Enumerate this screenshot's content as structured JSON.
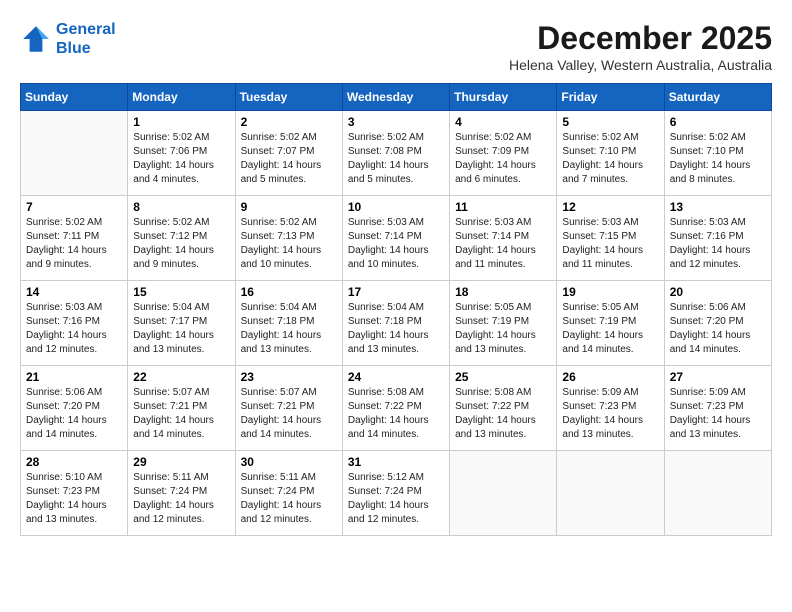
{
  "logo": {
    "line1": "General",
    "line2": "Blue"
  },
  "title": "December 2025",
  "location": "Helena Valley, Western Australia, Australia",
  "header_days": [
    "Sunday",
    "Monday",
    "Tuesday",
    "Wednesday",
    "Thursday",
    "Friday",
    "Saturday"
  ],
  "weeks": [
    [
      {
        "day": "",
        "sunrise": "",
        "sunset": "",
        "daylight": ""
      },
      {
        "day": "1",
        "sunrise": "Sunrise: 5:02 AM",
        "sunset": "Sunset: 7:06 PM",
        "daylight": "Daylight: 14 hours and 4 minutes."
      },
      {
        "day": "2",
        "sunrise": "Sunrise: 5:02 AM",
        "sunset": "Sunset: 7:07 PM",
        "daylight": "Daylight: 14 hours and 5 minutes."
      },
      {
        "day": "3",
        "sunrise": "Sunrise: 5:02 AM",
        "sunset": "Sunset: 7:08 PM",
        "daylight": "Daylight: 14 hours and 5 minutes."
      },
      {
        "day": "4",
        "sunrise": "Sunrise: 5:02 AM",
        "sunset": "Sunset: 7:09 PM",
        "daylight": "Daylight: 14 hours and 6 minutes."
      },
      {
        "day": "5",
        "sunrise": "Sunrise: 5:02 AM",
        "sunset": "Sunset: 7:10 PM",
        "daylight": "Daylight: 14 hours and 7 minutes."
      },
      {
        "day": "6",
        "sunrise": "Sunrise: 5:02 AM",
        "sunset": "Sunset: 7:10 PM",
        "daylight": "Daylight: 14 hours and 8 minutes."
      }
    ],
    [
      {
        "day": "7",
        "sunrise": "Sunrise: 5:02 AM",
        "sunset": "Sunset: 7:11 PM",
        "daylight": "Daylight: 14 hours and 9 minutes."
      },
      {
        "day": "8",
        "sunrise": "Sunrise: 5:02 AM",
        "sunset": "Sunset: 7:12 PM",
        "daylight": "Daylight: 14 hours and 9 minutes."
      },
      {
        "day": "9",
        "sunrise": "Sunrise: 5:02 AM",
        "sunset": "Sunset: 7:13 PM",
        "daylight": "Daylight: 14 hours and 10 minutes."
      },
      {
        "day": "10",
        "sunrise": "Sunrise: 5:03 AM",
        "sunset": "Sunset: 7:14 PM",
        "daylight": "Daylight: 14 hours and 10 minutes."
      },
      {
        "day": "11",
        "sunrise": "Sunrise: 5:03 AM",
        "sunset": "Sunset: 7:14 PM",
        "daylight": "Daylight: 14 hours and 11 minutes."
      },
      {
        "day": "12",
        "sunrise": "Sunrise: 5:03 AM",
        "sunset": "Sunset: 7:15 PM",
        "daylight": "Daylight: 14 hours and 11 minutes."
      },
      {
        "day": "13",
        "sunrise": "Sunrise: 5:03 AM",
        "sunset": "Sunset: 7:16 PM",
        "daylight": "Daylight: 14 hours and 12 minutes."
      }
    ],
    [
      {
        "day": "14",
        "sunrise": "Sunrise: 5:03 AM",
        "sunset": "Sunset: 7:16 PM",
        "daylight": "Daylight: 14 hours and 12 minutes."
      },
      {
        "day": "15",
        "sunrise": "Sunrise: 5:04 AM",
        "sunset": "Sunset: 7:17 PM",
        "daylight": "Daylight: 14 hours and 13 minutes."
      },
      {
        "day": "16",
        "sunrise": "Sunrise: 5:04 AM",
        "sunset": "Sunset: 7:18 PM",
        "daylight": "Daylight: 14 hours and 13 minutes."
      },
      {
        "day": "17",
        "sunrise": "Sunrise: 5:04 AM",
        "sunset": "Sunset: 7:18 PM",
        "daylight": "Daylight: 14 hours and 13 minutes."
      },
      {
        "day": "18",
        "sunrise": "Sunrise: 5:05 AM",
        "sunset": "Sunset: 7:19 PM",
        "daylight": "Daylight: 14 hours and 13 minutes."
      },
      {
        "day": "19",
        "sunrise": "Sunrise: 5:05 AM",
        "sunset": "Sunset: 7:19 PM",
        "daylight": "Daylight: 14 hours and 14 minutes."
      },
      {
        "day": "20",
        "sunrise": "Sunrise: 5:06 AM",
        "sunset": "Sunset: 7:20 PM",
        "daylight": "Daylight: 14 hours and 14 minutes."
      }
    ],
    [
      {
        "day": "21",
        "sunrise": "Sunrise: 5:06 AM",
        "sunset": "Sunset: 7:20 PM",
        "daylight": "Daylight: 14 hours and 14 minutes."
      },
      {
        "day": "22",
        "sunrise": "Sunrise: 5:07 AM",
        "sunset": "Sunset: 7:21 PM",
        "daylight": "Daylight: 14 hours and 14 minutes."
      },
      {
        "day": "23",
        "sunrise": "Sunrise: 5:07 AM",
        "sunset": "Sunset: 7:21 PM",
        "daylight": "Daylight: 14 hours and 14 minutes."
      },
      {
        "day": "24",
        "sunrise": "Sunrise: 5:08 AM",
        "sunset": "Sunset: 7:22 PM",
        "daylight": "Daylight: 14 hours and 14 minutes."
      },
      {
        "day": "25",
        "sunrise": "Sunrise: 5:08 AM",
        "sunset": "Sunset: 7:22 PM",
        "daylight": "Daylight: 14 hours and 13 minutes."
      },
      {
        "day": "26",
        "sunrise": "Sunrise: 5:09 AM",
        "sunset": "Sunset: 7:23 PM",
        "daylight": "Daylight: 14 hours and 13 minutes."
      },
      {
        "day": "27",
        "sunrise": "Sunrise: 5:09 AM",
        "sunset": "Sunset: 7:23 PM",
        "daylight": "Daylight: 14 hours and 13 minutes."
      }
    ],
    [
      {
        "day": "28",
        "sunrise": "Sunrise: 5:10 AM",
        "sunset": "Sunset: 7:23 PM",
        "daylight": "Daylight: 14 hours and 13 minutes."
      },
      {
        "day": "29",
        "sunrise": "Sunrise: 5:11 AM",
        "sunset": "Sunset: 7:24 PM",
        "daylight": "Daylight: 14 hours and 12 minutes."
      },
      {
        "day": "30",
        "sunrise": "Sunrise: 5:11 AM",
        "sunset": "Sunset: 7:24 PM",
        "daylight": "Daylight: 14 hours and 12 minutes."
      },
      {
        "day": "31",
        "sunrise": "Sunrise: 5:12 AM",
        "sunset": "Sunset: 7:24 PM",
        "daylight": "Daylight: 14 hours and 12 minutes."
      },
      {
        "day": "",
        "sunrise": "",
        "sunset": "",
        "daylight": ""
      },
      {
        "day": "",
        "sunrise": "",
        "sunset": "",
        "daylight": ""
      },
      {
        "day": "",
        "sunrise": "",
        "sunset": "",
        "daylight": ""
      }
    ]
  ]
}
